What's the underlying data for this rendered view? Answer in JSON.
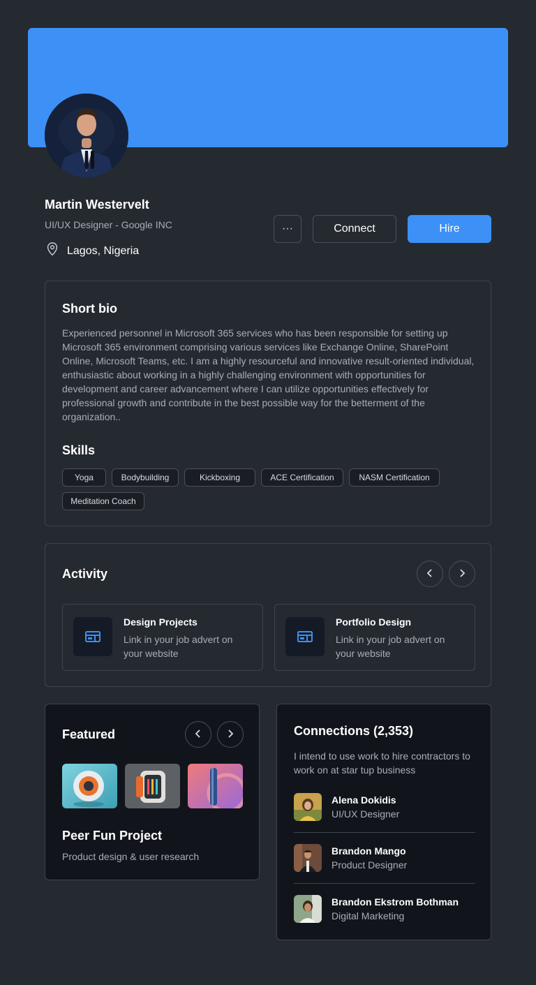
{
  "profile": {
    "name": "Martin Westervelt",
    "role": "UI/UX Designer - Google INC",
    "location": "Lagos, Nigeria",
    "more_label": "···",
    "connect_label": "Connect",
    "hire_label": "Hire"
  },
  "bio": {
    "title": "Short bio",
    "text": "Experienced personnel in Microsoft 365 services who has been responsible for setting up Microsoft 365 environment comprising various services like Exchange Online, SharePoint Online, Microsoft Teams, etc. I am a highly resourceful and innovative result-oriented individual, enthusiastic about working in a highly challenging environment with opportunities for development and career advancement where I can utilize opportunities effectively for professional growth and contribute in the best possible way for the betterment of the organization.."
  },
  "skills": {
    "title": "Skills",
    "items": [
      "Yoga",
      "Bodybuilding",
      "Kickboxing",
      "ACE Certification",
      "NASM Certification",
      "Meditation Coach"
    ]
  },
  "activity": {
    "title": "Activity",
    "items": [
      {
        "title": "Design Projects",
        "desc": "Link in your job advert on your website"
      },
      {
        "title": "Portfolio Design",
        "desc": "Link in your job advert on your website"
      }
    ]
  },
  "featured": {
    "title": "Featured",
    "project_title": "Peer Fun Project",
    "project_desc": "Product design & user research"
  },
  "connections": {
    "title": "Connections (2,353)",
    "desc": "I intend to use work to hire contractors to work on at star tup business",
    "items": [
      {
        "name": "Alena Dokidis",
        "role": "UI/UX Designer"
      },
      {
        "name": "Brandon Mango",
        "role": "Product Designer"
      },
      {
        "name": "Brandon Ekstrom Bothman",
        "role": "Digital Marketing"
      }
    ]
  },
  "colors": {
    "accent": "#3d90f5",
    "background": "#252a31",
    "card_dark": "#11151b"
  }
}
